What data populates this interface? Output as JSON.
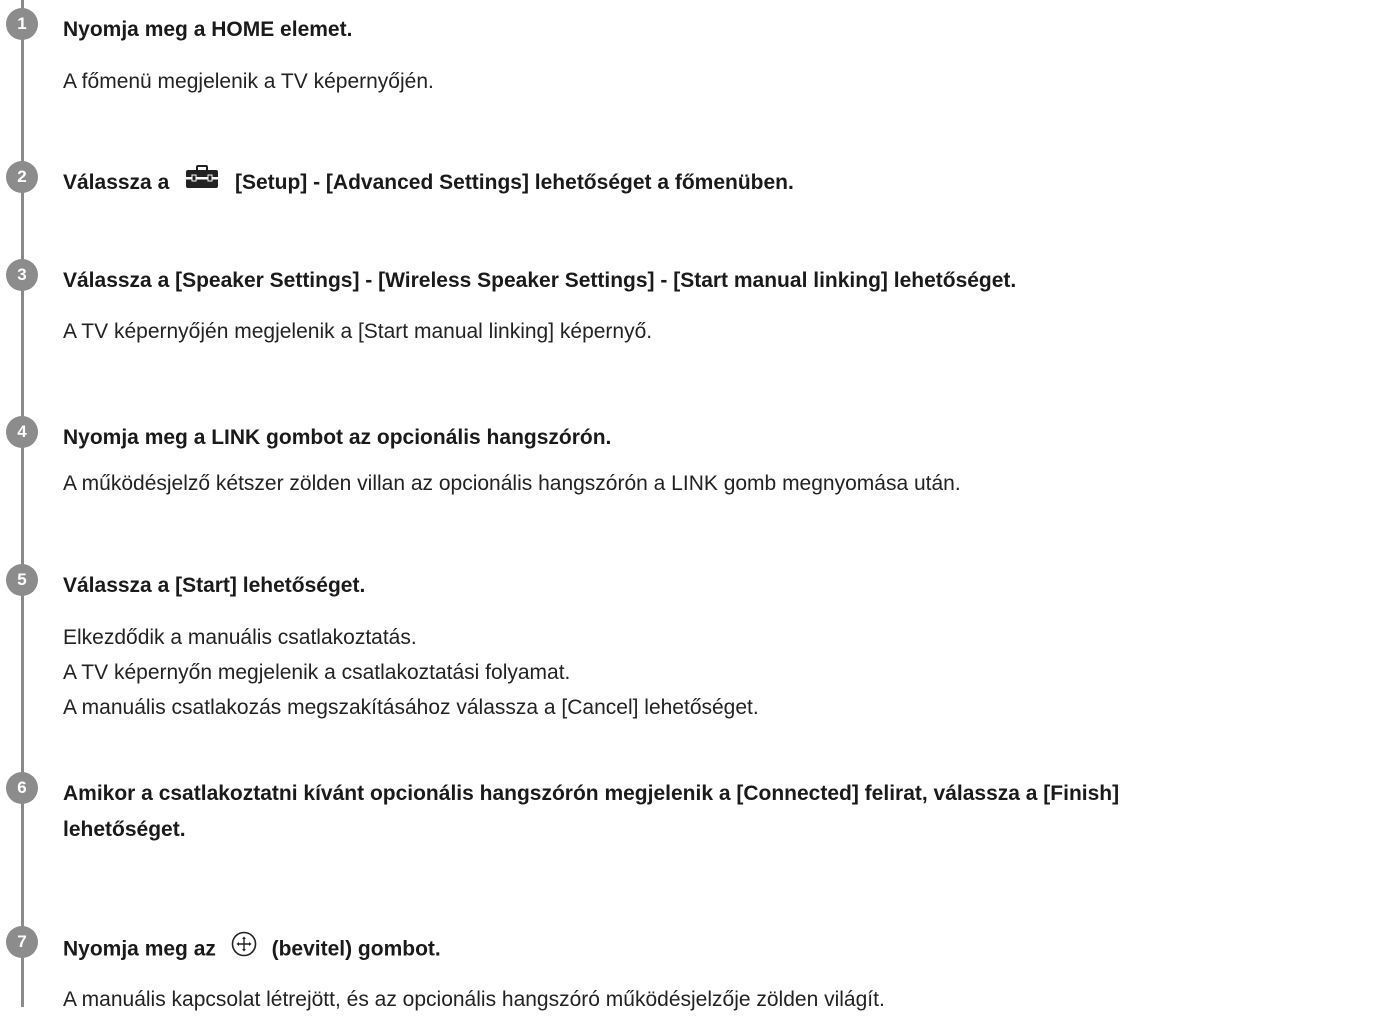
{
  "steps": [
    {
      "number": "1",
      "title": "Nyomja meg a HOME elemet.",
      "desc": [
        "A főmenü megjelenik a TV képernyőjén."
      ]
    },
    {
      "number": "2",
      "title_before": "Válassza a",
      "title_after": "[Setup] - [Advanced Settings] lehetőséget a főmenüben.",
      "icon": "toolbox-icon"
    },
    {
      "number": "3",
      "title": "Válassza a [Speaker Settings] - [Wireless Speaker Settings] - [Start manual linking] lehetőséget.",
      "desc": [
        "A TV képernyőjén megjelenik a [Start manual linking] képernyő."
      ]
    },
    {
      "number": "4",
      "title": "Nyomja meg a LINK gombot az opcionális hangszórón.",
      "desc": [
        "A működésjelző kétszer zölden villan az opcionális hangszórón a LINK gomb megnyomása után."
      ]
    },
    {
      "number": "5",
      "title": "Válassza a [Start] lehetőséget.",
      "desc": [
        "Elkezdődik a manuális csatlakoztatás.",
        "A TV képernyőn megjelenik a csatlakoztatási folyamat.",
        "A manuális csatlakozás megszakításához válassza a [Cancel] lehetőséget."
      ]
    },
    {
      "number": "6",
      "title_line1": "Amikor a csatlakoztatni kívánt opcionális hangszórón megjelenik a [Connected] felirat, válassza a [Finish]",
      "title_line2": "lehetőséget."
    },
    {
      "number": "7",
      "title_before": "Nyomja meg az",
      "title_after": "(bevitel) gombot.",
      "icon": "enter-button-icon",
      "desc": [
        "A manuális kapcsolat létrejött, és az opcionális hangszóró működésjelzője zölden világít."
      ]
    }
  ]
}
